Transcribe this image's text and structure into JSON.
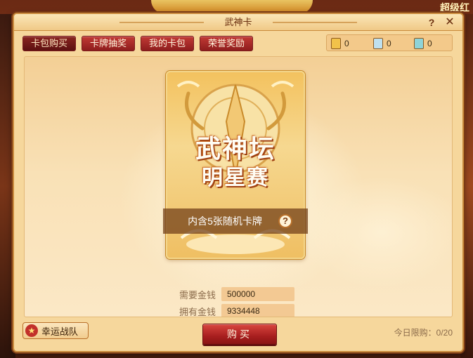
{
  "background": {
    "corner_text": "超级红"
  },
  "dialog": {
    "title": "武神卡",
    "help_glyph": "?",
    "close_glyph": "✕"
  },
  "tabs": [
    {
      "label": "卡包购买",
      "active": true
    },
    {
      "label": "卡牌抽奖",
      "active": false
    },
    {
      "label": "我的卡包",
      "active": false
    },
    {
      "label": "荣誉奖励",
      "active": false
    }
  ],
  "currencies": [
    {
      "icon": "gold-ticket-icon",
      "color": "#f2c24a",
      "value": "0"
    },
    {
      "icon": "silver-ticket-icon",
      "color": "#bfe0ef",
      "value": "0"
    },
    {
      "icon": "cyan-ticket-icon",
      "color": "#8fd3d8",
      "value": "0"
    }
  ],
  "card": {
    "title_line1": "武神坛",
    "title_line2": "明星赛",
    "caption": "内含5张随机卡牌",
    "help_glyph": "?"
  },
  "cost": {
    "need_label": "需要金钱",
    "need_value": "500000",
    "own_label": "拥有金钱",
    "own_value": "9334448"
  },
  "lucky_team": {
    "icon": "star-icon",
    "label": "幸运战队"
  },
  "buy_button": {
    "label": "购买"
  },
  "daily_limit": {
    "text": "今日限购：0/20"
  },
  "colors": {
    "tab_red": "#a82a26",
    "panel_bg": "#f6d79c",
    "card_gold": "#f3c25f"
  }
}
